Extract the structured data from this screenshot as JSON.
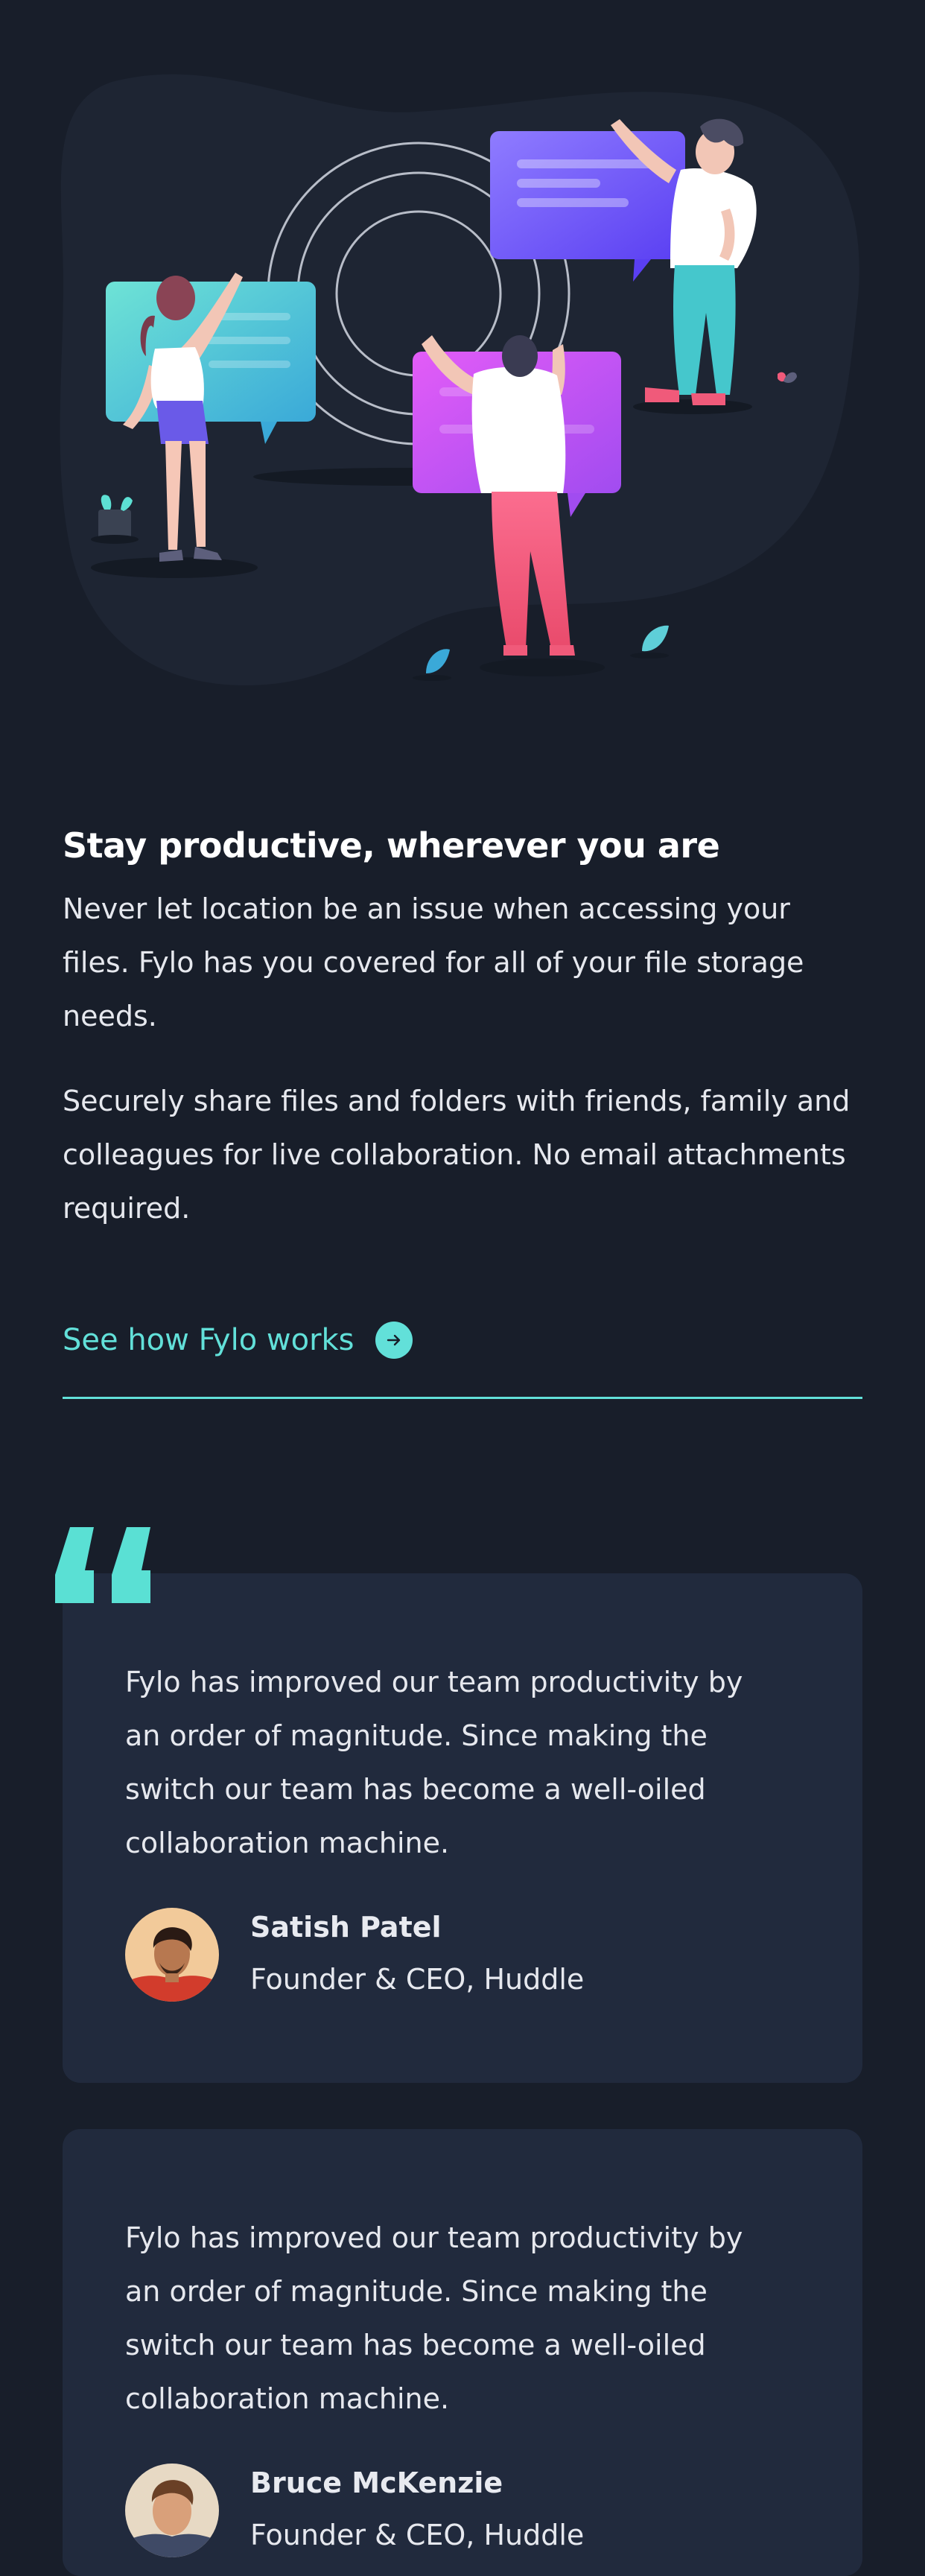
{
  "productive": {
    "heading": "Stay productive, wherever you are",
    "paragraph_1": "Never let location be an issue when accessing your files. Fylo has you covered for all of your file storage needs.",
    "paragraph_2": "Securely share files and folders with friends, family and colleagues for live collaboration. No email attachments required.",
    "link_label": "See how Fylo works"
  },
  "testimonials": [
    {
      "quote": "Fylo has improved our team productivity by an order of magnitude. Since making the switch our team has become a well-oiled collaboration machine.",
      "name": "Satish Patel",
      "role": "Founder & CEO, Huddle"
    },
    {
      "quote": "Fylo has improved our team productivity by an order of magnitude. Since making the switch our team has become a well-oiled collaboration machine.",
      "name": "Bruce McKenzie",
      "role": "Founder & CEO, Huddle"
    }
  ],
  "colors": {
    "background": "#181e2a",
    "card": "#212a3d",
    "accent": "#62e0d9"
  },
  "icons": {
    "cta_arrow": "arrow-right-circle-icon",
    "quote": "quotation-mark-icon"
  }
}
